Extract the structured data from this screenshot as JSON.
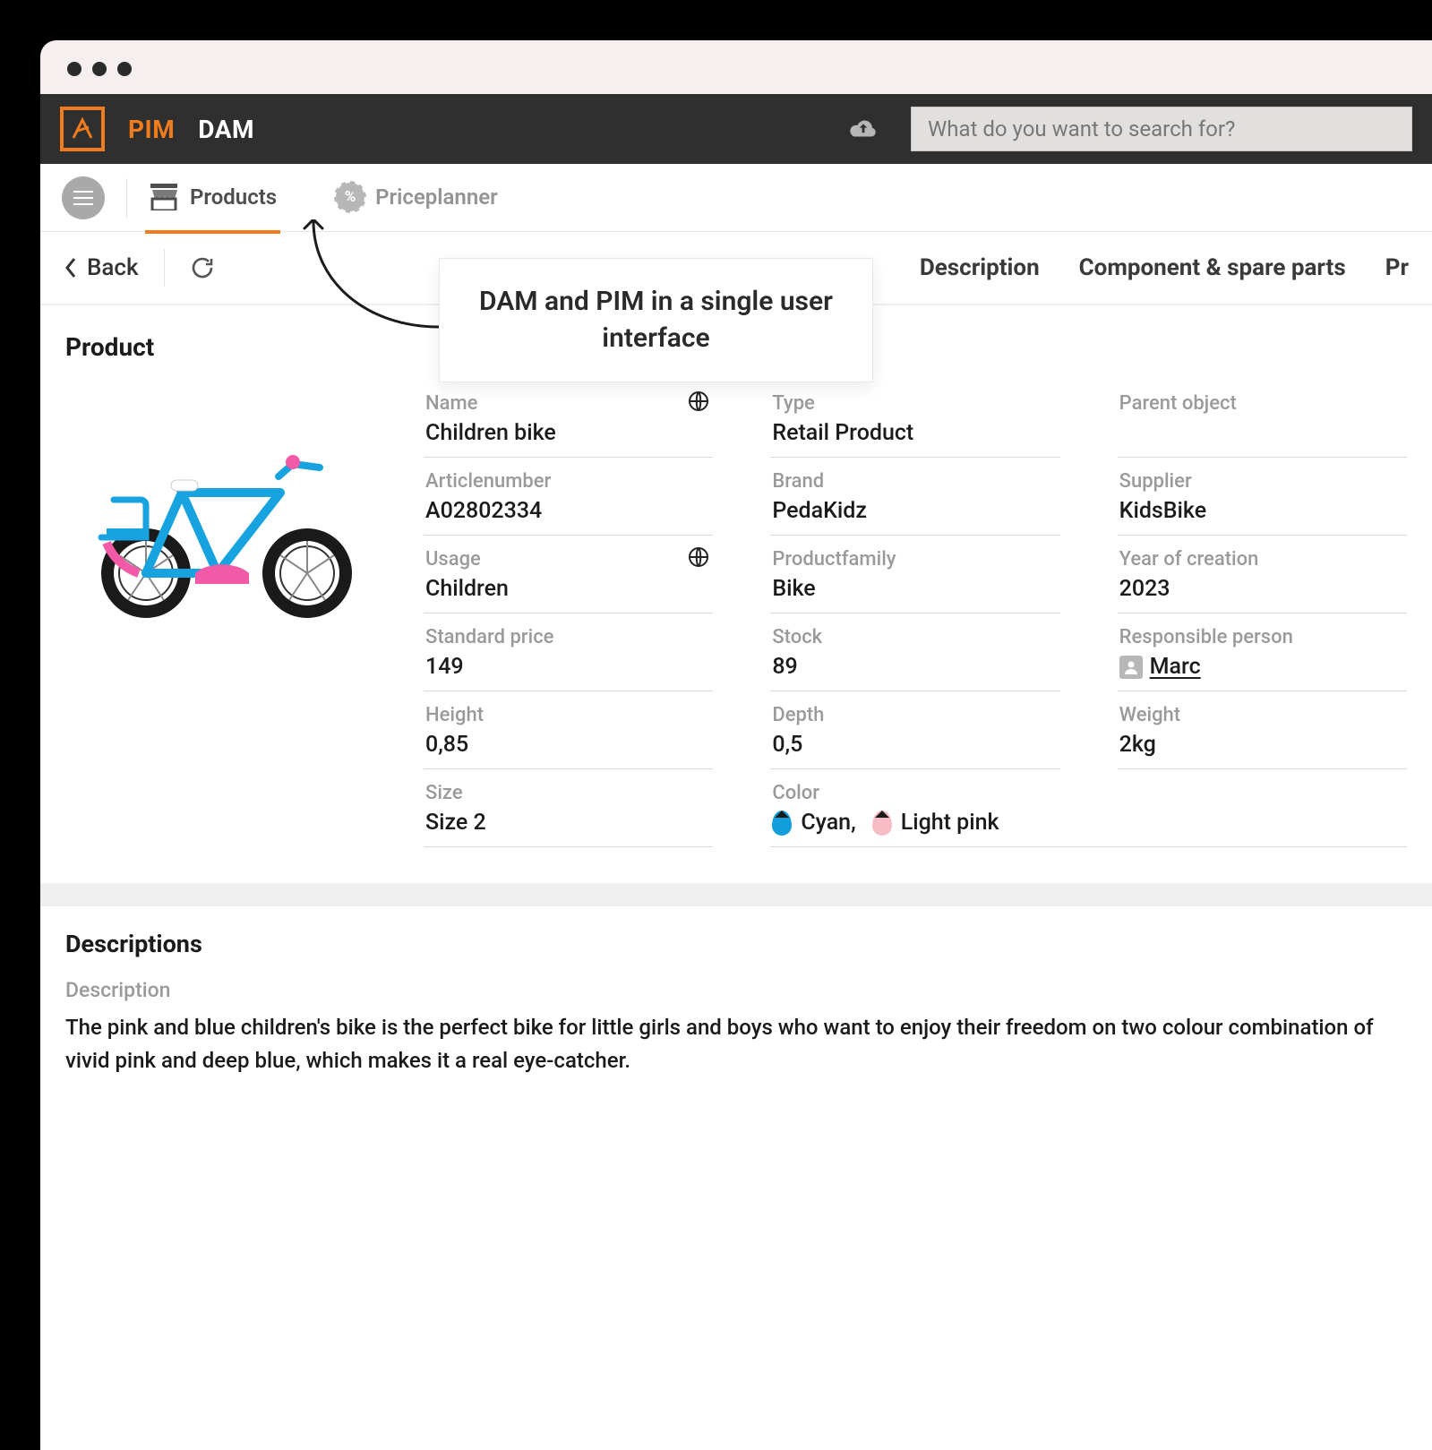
{
  "topbar": {
    "pim": "PIM",
    "dam": "DAM",
    "search_placeholder": "What do you want to search for?"
  },
  "subnav": {
    "products": "Products",
    "priceplanner": "Priceplanner"
  },
  "toolbar": {
    "back": "Back"
  },
  "tabs": {
    "description": "Description",
    "spare": "Component & spare parts",
    "pr": "Pr"
  },
  "callout": {
    "text": "DAM and PIM in a single user interface"
  },
  "product": {
    "section_title": "Product",
    "fields": {
      "name": {
        "label": "Name",
        "value": "Children bike"
      },
      "type": {
        "label": "Type",
        "value": "Retail Product"
      },
      "parent": {
        "label": "Parent object",
        "value": ""
      },
      "article": {
        "label": "Articlenumber",
        "value": "A02802334"
      },
      "brand": {
        "label": "Brand",
        "value": "PedaKidz"
      },
      "supplier": {
        "label": "Supplier",
        "value": "KidsBike"
      },
      "usage": {
        "label": "Usage",
        "value": "Children"
      },
      "family": {
        "label": "Productfamily",
        "value": "Bike"
      },
      "year": {
        "label": "Year of creation",
        "value": "2023"
      },
      "price": {
        "label": "Standard price",
        "value": "149"
      },
      "stock": {
        "label": "Stock",
        "value": "89"
      },
      "responsible": {
        "label": "Responsible person",
        "value": "Marc"
      },
      "height": {
        "label": "Height",
        "value": "0,85"
      },
      "depth": {
        "label": "Depth",
        "value": "0,5"
      },
      "weight": {
        "label": "Weight",
        "value": "2kg"
      },
      "size": {
        "label": "Size",
        "value": "Size 2"
      },
      "color": {
        "label": "Color",
        "cyan": "Cyan,",
        "pink": "Light pink"
      }
    }
  },
  "descriptions": {
    "section_title": "Descriptions",
    "label": "Description",
    "text": "The pink and blue children's bike is the perfect bike for little girls and boys who want to enjoy their freedom on two colour combination of vivid pink and deep blue, which makes it a real eye-catcher."
  }
}
